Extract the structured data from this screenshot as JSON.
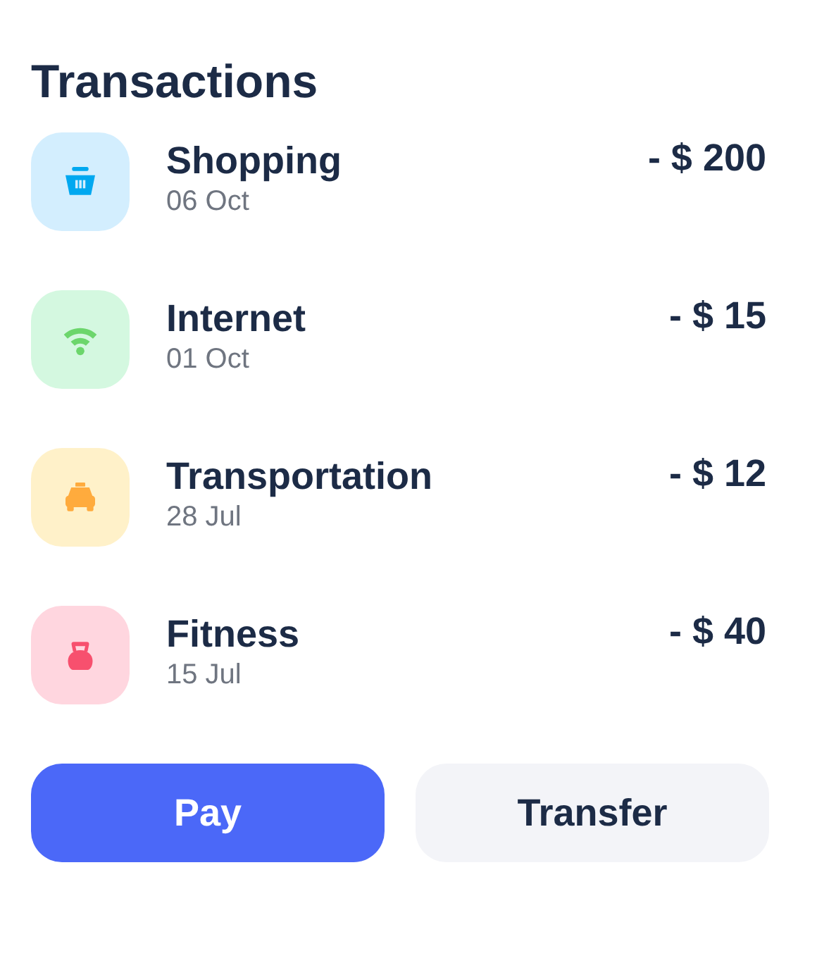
{
  "title": "Transactions",
  "transactions": [
    {
      "kind": "basket",
      "color": "#00a8f0",
      "name": "Shopping",
      "date": "06 Oct",
      "amount": "- $ 200"
    },
    {
      "kind": "wifi",
      "color": "#6cd66c",
      "name": "Internet",
      "date": "01 Oct",
      "amount": "- $ 15"
    },
    {
      "kind": "taxi",
      "color": "#ffab3d",
      "name": "Transportation",
      "date": "28 Jul",
      "amount": "- $ 12"
    },
    {
      "kind": "kettlebell",
      "color": "#f7506e",
      "name": "Fitness",
      "date": "15 Jul",
      "amount": "- $ 40"
    }
  ],
  "buttons": [
    {
      "label": "Pay",
      "kind": "primary"
    },
    {
      "label": "Transfer",
      "kind": "secondary"
    }
  ]
}
